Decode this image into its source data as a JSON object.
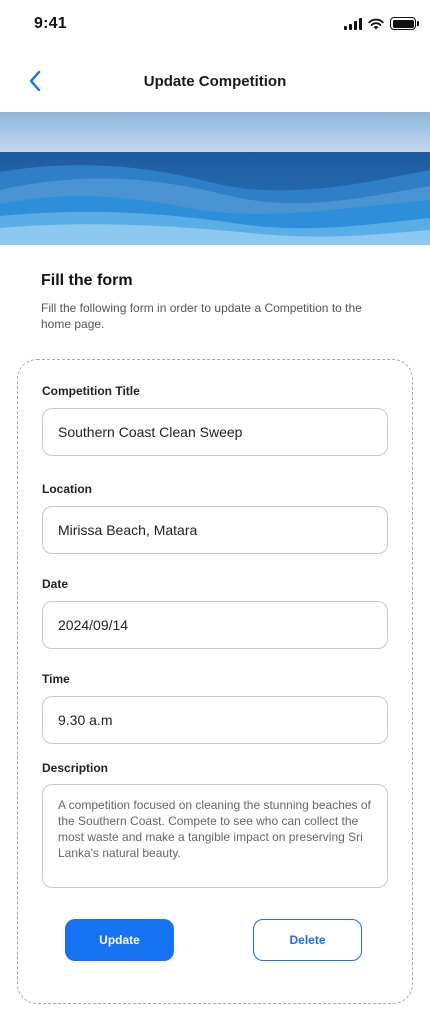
{
  "status_bar": {
    "time": "9:41"
  },
  "nav": {
    "title": "Update Competition",
    "back_icon": "chevron-left-icon"
  },
  "form_intro": {
    "heading": "Fill the form",
    "subtext": "Fill the following form in order to update a Competition to the home page."
  },
  "form": {
    "fields": [
      {
        "label": "Competition Title",
        "value": "Southern Coast Clean Sweep"
      },
      {
        "label": "Location",
        "value": "Mirissa Beach, Matara"
      },
      {
        "label": "Date",
        "value": "2024/09/14"
      },
      {
        "label": "Time",
        "value": "9.30 a.m"
      }
    ],
    "description": {
      "label": "Description",
      "value": "A competition focused on cleaning the stunning beaches of the Southern Coast. Compete to see who can collect the most waste and make a tangible impact on preserving Sri Lanka's natural beauty."
    },
    "update_label": "Update",
    "delete_label": "Delete"
  },
  "colors": {
    "accent": "#1572f3",
    "border": "#c8c8c8",
    "dashed_border": "#a8a8a8"
  }
}
